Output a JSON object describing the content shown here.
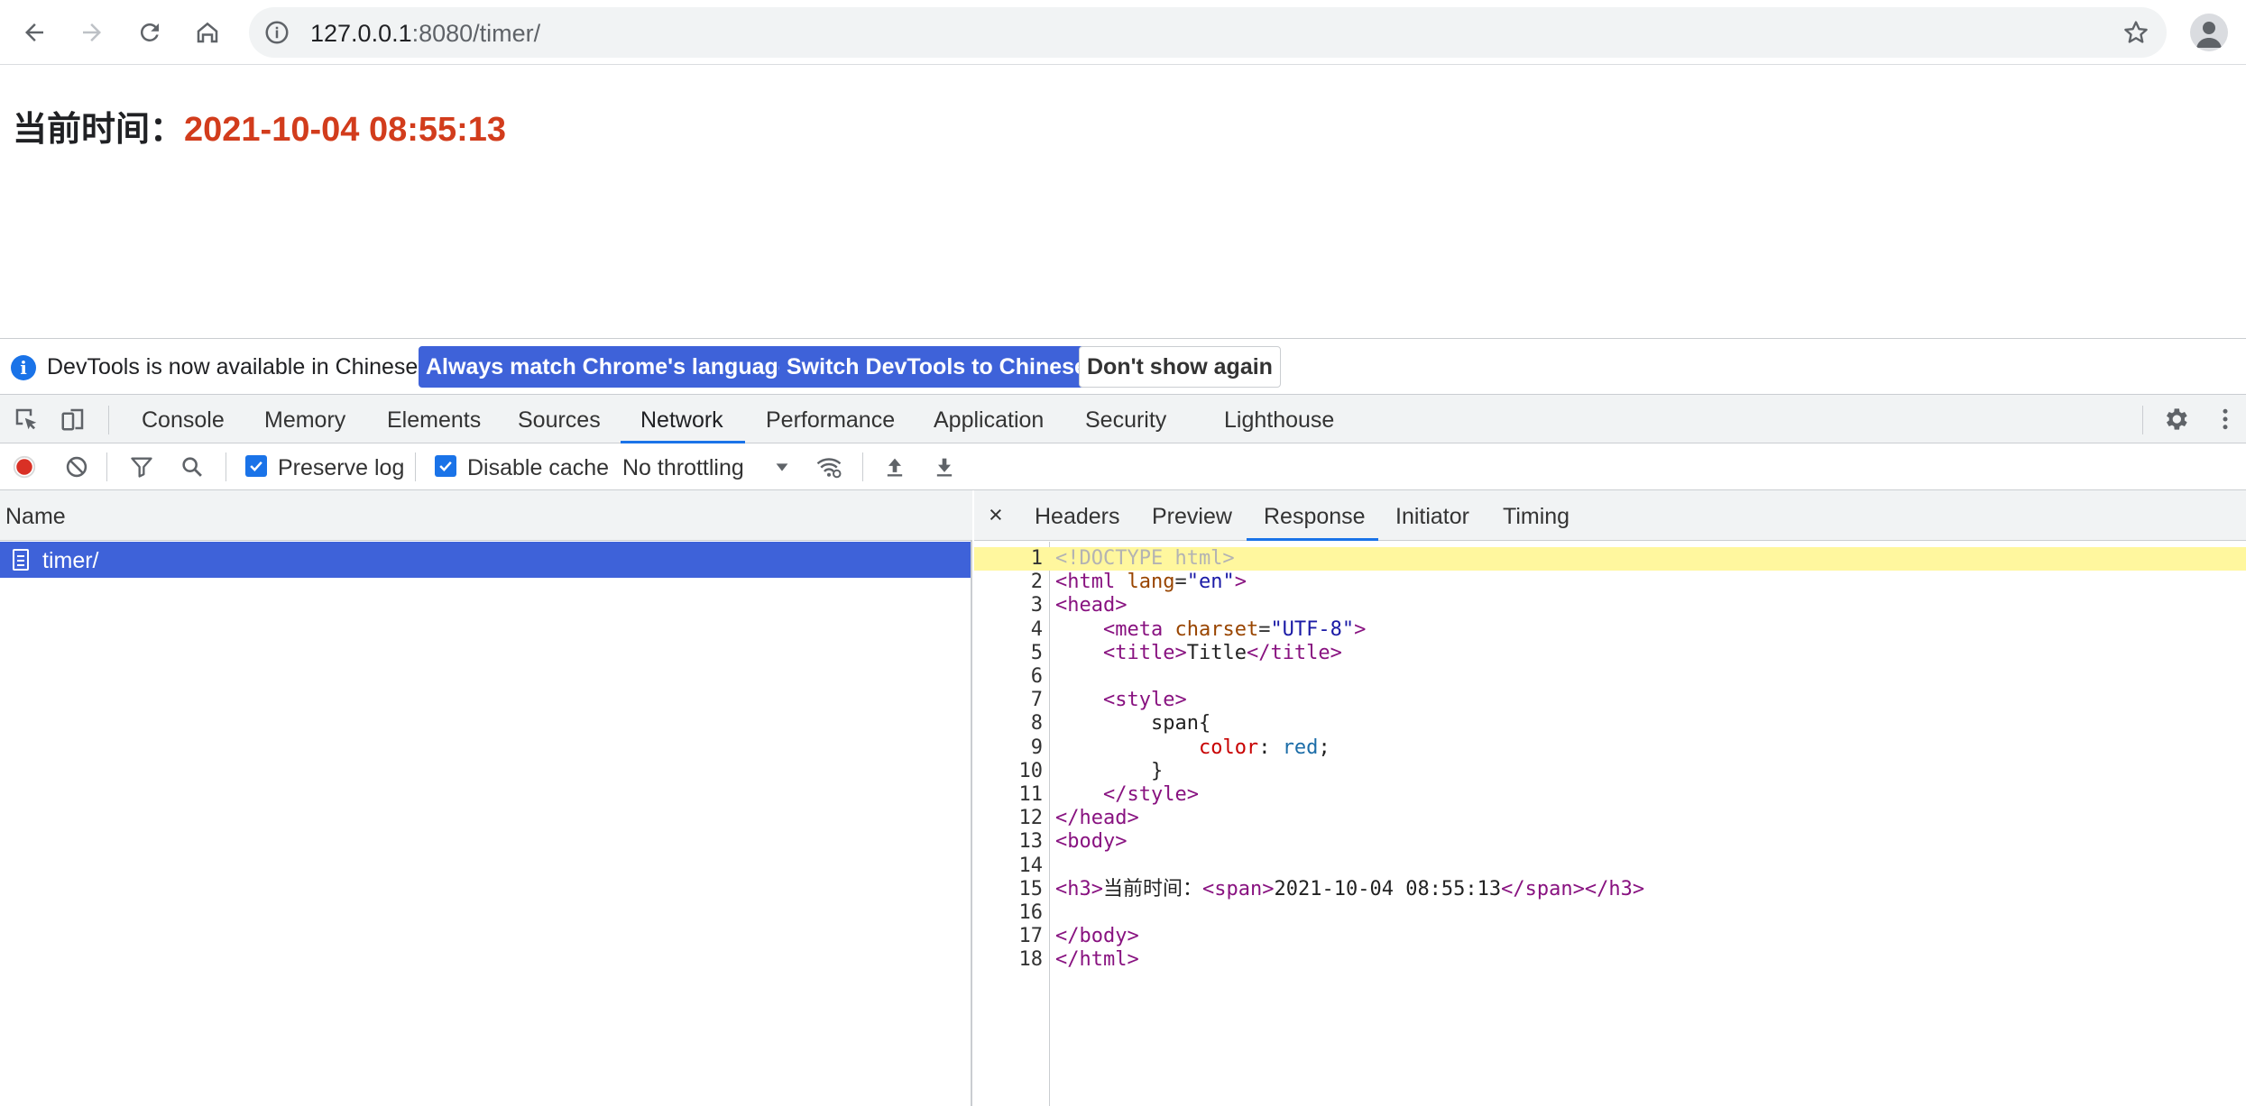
{
  "browser": {
    "url_host": "127.0.0.1",
    "url_path": ":8080/timer/",
    "icons": [
      "back-arrow-icon",
      "forward-arrow-icon",
      "reload-icon",
      "home-icon",
      "info-icon",
      "star-icon",
      "profile-icon"
    ]
  },
  "page": {
    "label": "当前时间：",
    "time": "2021-10-04 08:55:13",
    "time_color": "#d23c1c"
  },
  "devtools": {
    "infobar": {
      "message": "DevTools is now available in Chinese!",
      "btn_match": "Always match Chrome's language",
      "btn_switch": "Switch DevTools to Chinese",
      "btn_dismiss": "Don't show again"
    },
    "tabs": [
      "Console",
      "Memory",
      "Elements",
      "Sources",
      "Network",
      "Performance",
      "Application",
      "Security",
      "Lighthouse"
    ],
    "active_tab": "Network",
    "network": {
      "preserve_log": "Preserve log",
      "disable_cache": "Disable cache",
      "throttling": "No throttling"
    },
    "requests": {
      "header": "Name",
      "rows": [
        "timer/"
      ]
    },
    "detail": {
      "tabs": [
        "Headers",
        "Preview",
        "Response",
        "Initiator",
        "Timing"
      ],
      "active": "Response",
      "close": "×"
    },
    "response_lines": [
      "<!DOCTYPE html>",
      "<html lang=\"en\">",
      "<head>",
      "    <meta charset=\"UTF-8\">",
      "    <title>Title</title>",
      "",
      "    <style>",
      "        span{",
      "            color: red;",
      "        }",
      "    </style>",
      "</head>",
      "<body>",
      "",
      "<h3>当前时间：<span>2021-10-04 08:55:13</span></h3>",
      "",
      "</body>",
      "</html>"
    ],
    "accent_color": "#3e62d9"
  }
}
